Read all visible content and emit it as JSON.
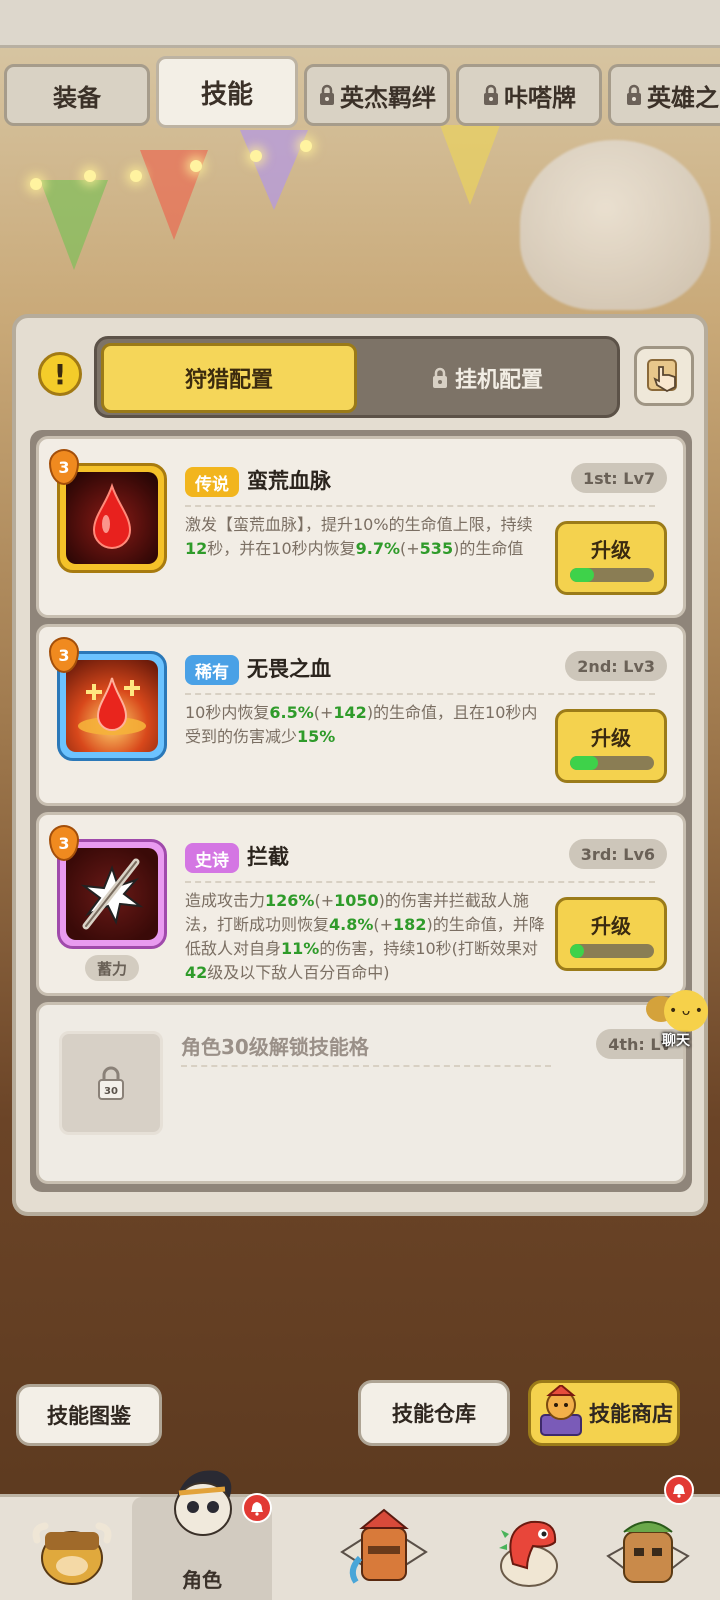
{
  "tabs": [
    {
      "label": "装备",
      "locked": false,
      "active": false
    },
    {
      "label": "技能",
      "locked": false,
      "active": true
    },
    {
      "label": "英杰羁绊",
      "locked": true,
      "active": false
    },
    {
      "label": "咔嗒牌",
      "locked": true,
      "active": false
    },
    {
      "label": "英雄之",
      "locked": true,
      "active": false
    }
  ],
  "config": {
    "hunt_label": "狩猎配置",
    "idle_label": "挂机配置"
  },
  "skills": [
    {
      "rarity": "传说",
      "rarity_color": "#f2b51d",
      "name": "蛮荒血脉",
      "slot": "1st: Lv7",
      "level_badge": "3",
      "desc_parts": [
        "激发【蛮荒血脉】，提升10%的生命值上限，持续",
        "12",
        "秒，并在10秒内恢复",
        "9.7%",
        "(+",
        "535",
        ")的生命值"
      ],
      "upgrade_label": "升级",
      "progress": 0.28
    },
    {
      "rarity": "稀有",
      "rarity_color": "#4aa1e6",
      "name": "无畏之血",
      "slot": "2nd: Lv3",
      "level_badge": "3",
      "desc_parts": [
        "10秒内恢复",
        "6.5%",
        "(+",
        "142",
        ")的生命值，且在10秒内受到的伤害减少",
        "15%",
        ""
      ],
      "upgrade_label": "升级",
      "progress": 0.33
    },
    {
      "rarity": "史诗",
      "rarity_color": "#d476e3",
      "name": "拦截",
      "slot": "3rd: Lv6",
      "level_badge": "3",
      "charge_label": "蓄力",
      "desc_parts": [
        "造成攻击力",
        "126%",
        "(+",
        "1050",
        ")的伤害并拦截敌人施法，打断成功则恢复",
        "4.8%",
        "(+",
        "182",
        ")的生命值，并降低敌人对自身",
        "11%",
        "的伤害，持续10秒(打断效果对",
        "42",
        "级及以下敌人百分百命中)"
      ],
      "upgrade_label": "升级",
      "progress": 0.17
    }
  ],
  "locked_slot": {
    "title": "角色30级解锁技能格",
    "slot": "4th: Lv",
    "lock_level": "30"
  },
  "chat_label": "聊天",
  "bottom_buttons": {
    "codex": "技能图鉴",
    "warehouse": "技能仓库",
    "shop": "技能商店"
  },
  "nav": {
    "role_label": "角色"
  },
  "icons": {
    "warn": "exclamation-icon",
    "guide": "hand-guide-icon",
    "lock": "lock-icon"
  }
}
